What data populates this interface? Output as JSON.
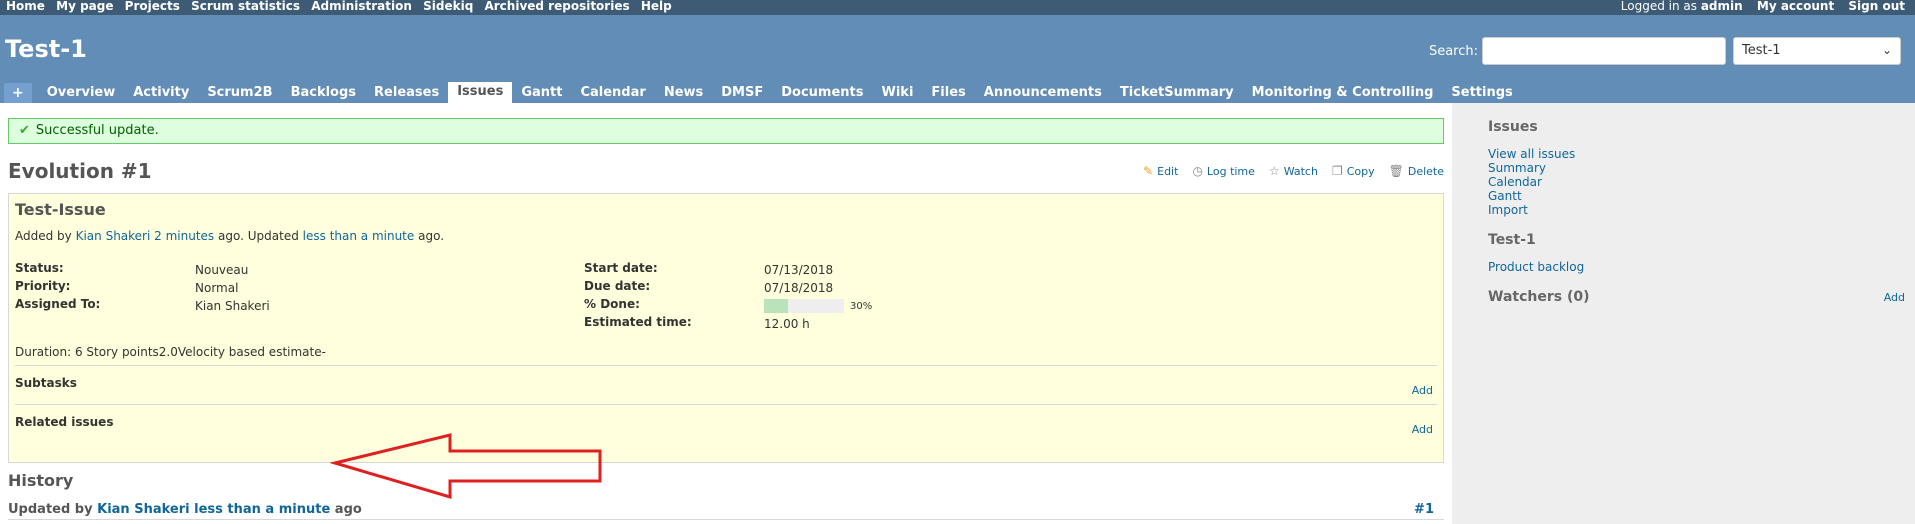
{
  "top_menu": {
    "left": [
      "Home",
      "My page",
      "Projects",
      "Scrum statistics",
      "Administration",
      "Sidekiq",
      "Archived repositories",
      "Help"
    ],
    "logged_in_prefix": "Logged in as",
    "logged_in_user": "admin",
    "right": [
      "My account",
      "Sign out"
    ]
  },
  "header": {
    "project_title": "Test-1",
    "search_label": "Search:",
    "search_value": "",
    "project_jump": "Test-1"
  },
  "main_menu": {
    "plus": "+",
    "tabs": [
      "Overview",
      "Activity",
      "Scrum2B",
      "Backlogs",
      "Releases",
      "Issues",
      "Gantt",
      "Calendar",
      "News",
      "DMSF",
      "Documents",
      "Wiki",
      "Files",
      "Announcements",
      "TicketSummary",
      "Monitoring & Controlling",
      "Settings"
    ],
    "selected": "Issues"
  },
  "flash": {
    "notice": "Successful update."
  },
  "issue": {
    "heading": "Evolution #1",
    "actions": {
      "edit": "Edit",
      "log_time": "Log time",
      "watch": "Watch",
      "copy": "Copy",
      "delete": "Delete"
    },
    "subject": "Test-Issue",
    "added_by_prefix": "Added by",
    "author": "Kian Shakeri",
    "created_ago": "2 minutes",
    "updated_mid": "ago. Updated",
    "updated_ago": "less than a minute",
    "updated_suffix": "ago.",
    "attributes_left": [
      {
        "label": "Status:",
        "value": "Nouveau"
      },
      {
        "label": "Priority:",
        "value": "Normal"
      },
      {
        "label": "Assigned To:",
        "value": "Kian Shakeri"
      }
    ],
    "attributes_right": [
      {
        "label": "Start date:",
        "value": "07/13/2018"
      },
      {
        "label": "Due date:",
        "value": "07/18/2018"
      },
      {
        "label": "% Done:",
        "value": "30%",
        "percent": 30
      },
      {
        "label": "Estimated time:",
        "value": "12.00 h"
      }
    ],
    "custom_field": "Duration: 6 Story points2.0Velocity based estimate-",
    "subtasks_label": "Subtasks",
    "related_label": "Related issues",
    "add_label": "Add"
  },
  "history": {
    "title": "History",
    "updated_by_prefix": "Updated by",
    "author": "Kian Shakeri",
    "ago": "less than a minute",
    "ago_suffix": "ago",
    "note_ref": "#1"
  },
  "sidebar": {
    "issues_title": "Issues",
    "issues_links": [
      "View all issues",
      "Summary",
      "Calendar",
      "Gantt",
      "Import"
    ],
    "project_title": "Test-1",
    "project_links": [
      "Product backlog"
    ],
    "watchers_title": "Watchers (0)",
    "watchers_add": "Add"
  },
  "colors": {
    "top_menu_bg": "#3e5b76",
    "header_bg": "#628db6",
    "flash_bg": "#dfd",
    "issue_bg": "#ffffdd",
    "link": "#169",
    "annotation_arrow": "#e02020"
  }
}
